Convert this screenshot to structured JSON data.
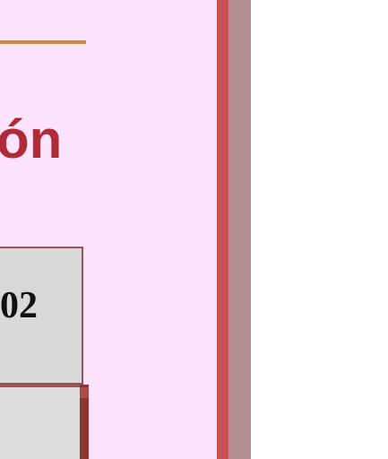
{
  "page": {
    "heading": "ón",
    "cell_value": "02"
  },
  "colors": {
    "panel_background": "#fee3fd",
    "panel_border": "#c55252",
    "panel_shadow": "#b38f8f",
    "accent_rule": "#d2863a",
    "heading_text": "#b02a37",
    "cell_background": "#d9d9d9",
    "cell_border": "#a05050"
  }
}
